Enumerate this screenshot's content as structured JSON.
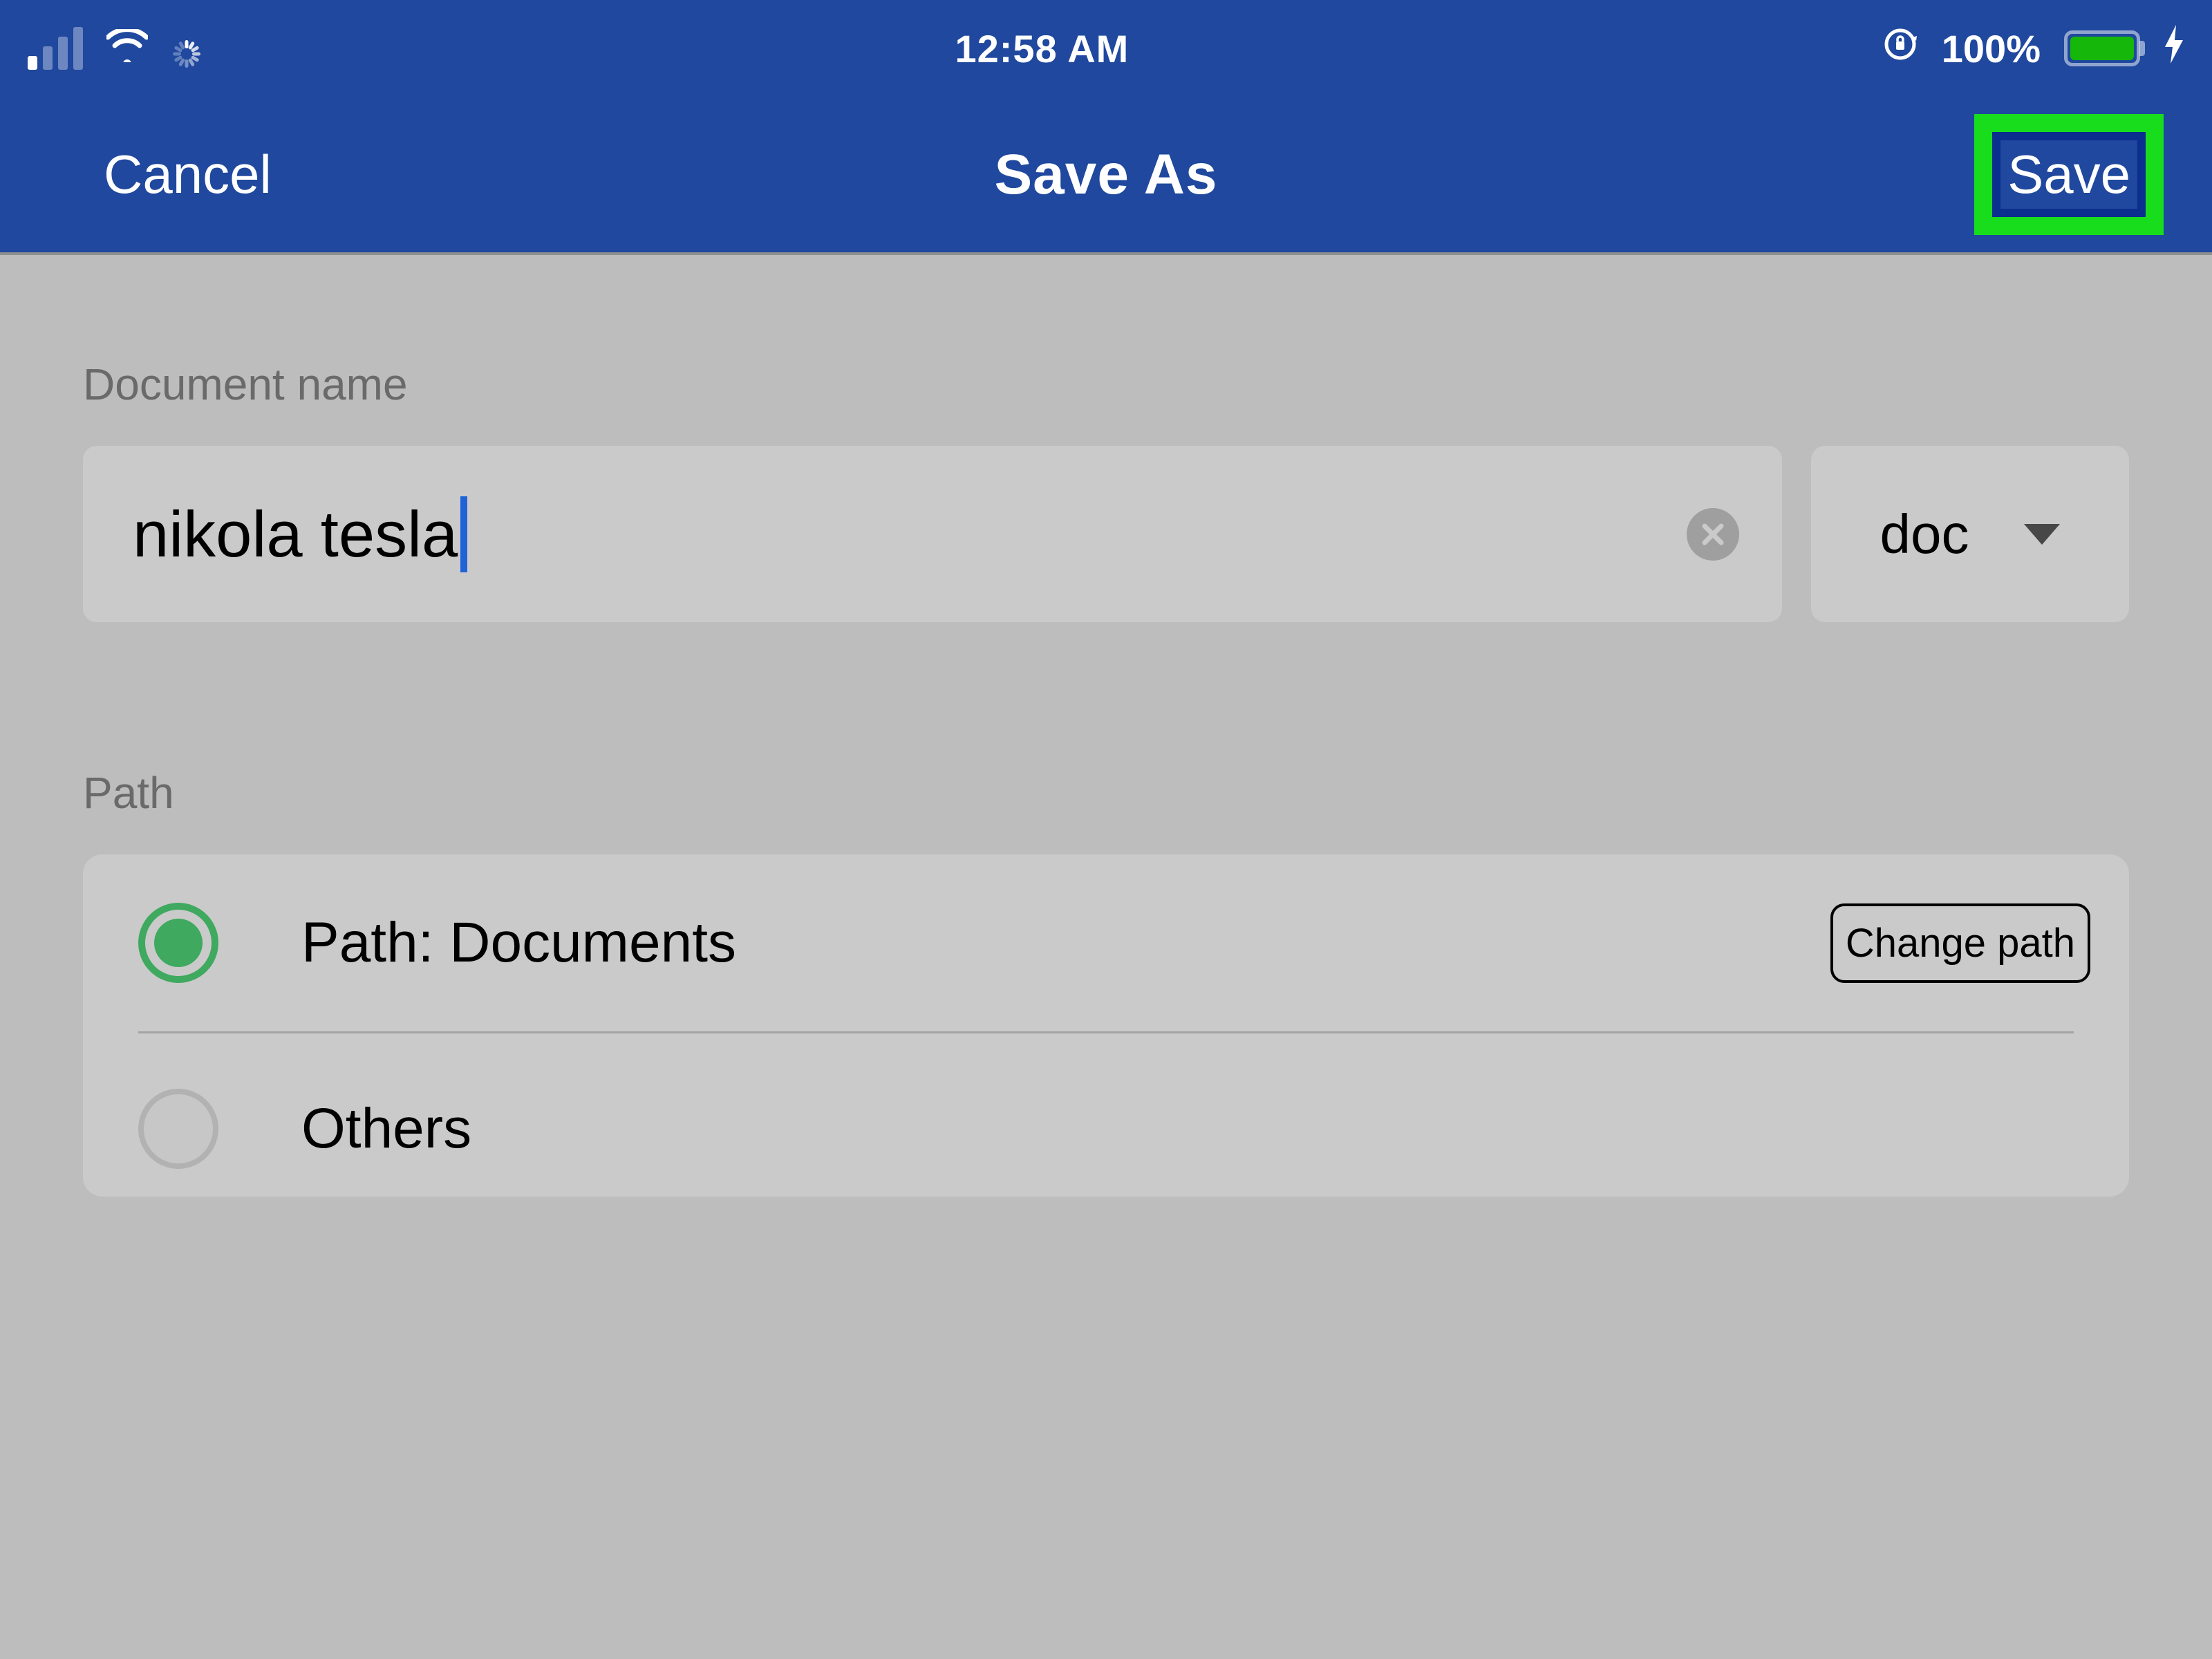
{
  "status_bar": {
    "time": "12:58 AM",
    "battery_percent": "100%",
    "icons": {
      "signal": "cellular-signal-icon",
      "wifi": "wifi-icon",
      "spinner": "loading-spinner-icon",
      "orientation_lock": "orientation-lock-icon",
      "battery": "battery-icon",
      "charging": "charging-bolt-icon"
    }
  },
  "nav": {
    "cancel_label": "Cancel",
    "title": "Save As",
    "save_label": "Save"
  },
  "document_name": {
    "section_label": "Document name",
    "value": "nikola tesla",
    "clear_icon": "clear-x-icon",
    "extension_selected": "doc",
    "extension_dropdown_icon": "chevron-down-icon"
  },
  "path": {
    "section_label": "Path",
    "options": [
      {
        "label_prefix": "Path: ",
        "label_value": "Documents",
        "selected": true
      },
      {
        "label_prefix": "",
        "label_value": "Others",
        "selected": false
      }
    ],
    "change_path_label": "Change path"
  },
  "colors": {
    "header_bg": "#1f489e",
    "highlight_green": "#18dd1c",
    "content_bg": "#bdbdbd",
    "card_bg": "#cacaca",
    "radio_green": "#3fa95f",
    "battery_green": "#15b70a"
  }
}
